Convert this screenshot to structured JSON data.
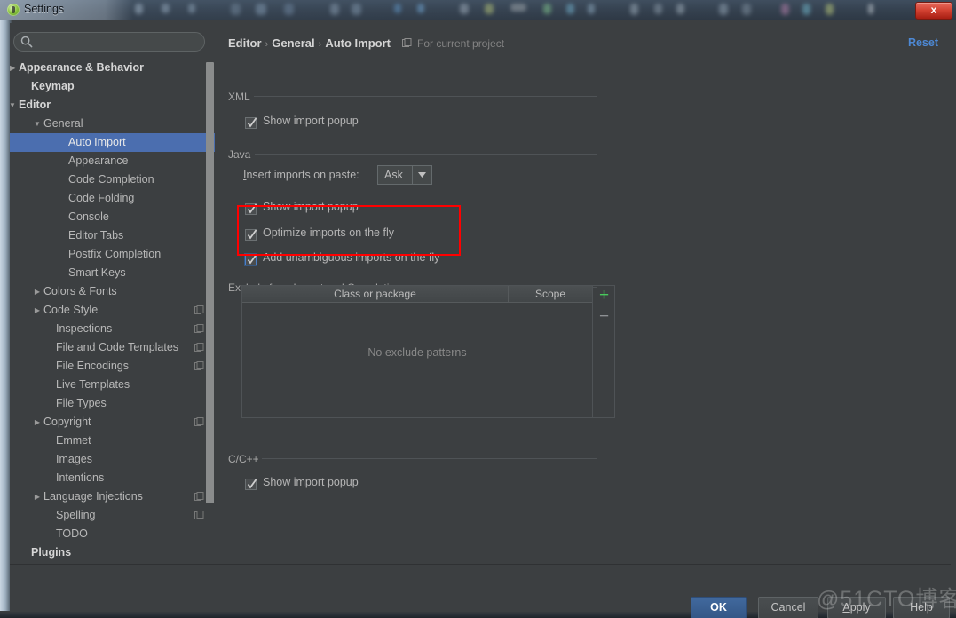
{
  "window": {
    "title": "Settings",
    "close_label": "x",
    "app_icon": "intellij-idea-icon"
  },
  "sidebar": {
    "search": {
      "value": "",
      "placeholder": "",
      "icon": "search-icon"
    },
    "items": [
      {
        "label": "Appearance & Behavior",
        "indent": 10,
        "arrow": "collapsed",
        "bold": true,
        "selected": false,
        "project_icon": false
      },
      {
        "label": "Keymap",
        "indent": 24,
        "arrow": "none",
        "bold": true,
        "selected": false,
        "project_icon": false
      },
      {
        "label": "Editor",
        "indent": 10,
        "arrow": "expanded",
        "bold": true,
        "selected": false,
        "project_icon": false
      },
      {
        "label": "General",
        "indent": 38,
        "arrow": "expanded",
        "bold": false,
        "selected": false,
        "project_icon": false
      },
      {
        "label": "Auto Import",
        "indent": 66,
        "arrow": "none",
        "bold": false,
        "selected": true,
        "project_icon": false
      },
      {
        "label": "Appearance",
        "indent": 66,
        "arrow": "none",
        "bold": false,
        "selected": false,
        "project_icon": false
      },
      {
        "label": "Code Completion",
        "indent": 66,
        "arrow": "none",
        "bold": false,
        "selected": false,
        "project_icon": false
      },
      {
        "label": "Code Folding",
        "indent": 66,
        "arrow": "none",
        "bold": false,
        "selected": false,
        "project_icon": false
      },
      {
        "label": "Console",
        "indent": 66,
        "arrow": "none",
        "bold": false,
        "selected": false,
        "project_icon": false
      },
      {
        "label": "Editor Tabs",
        "indent": 66,
        "arrow": "none",
        "bold": false,
        "selected": false,
        "project_icon": false
      },
      {
        "label": "Postfix Completion",
        "indent": 66,
        "arrow": "none",
        "bold": false,
        "selected": false,
        "project_icon": false
      },
      {
        "label": "Smart Keys",
        "indent": 66,
        "arrow": "none",
        "bold": false,
        "selected": false,
        "project_icon": false
      },
      {
        "label": "Colors & Fonts",
        "indent": 38,
        "arrow": "collapsed",
        "bold": false,
        "selected": false,
        "project_icon": false
      },
      {
        "label": "Code Style",
        "indent": 38,
        "arrow": "collapsed",
        "bold": false,
        "selected": false,
        "project_icon": true
      },
      {
        "label": "Inspections",
        "indent": 52,
        "arrow": "none",
        "bold": false,
        "selected": false,
        "project_icon": true
      },
      {
        "label": "File and Code Templates",
        "indent": 52,
        "arrow": "none",
        "bold": false,
        "selected": false,
        "project_icon": true
      },
      {
        "label": "File Encodings",
        "indent": 52,
        "arrow": "none",
        "bold": false,
        "selected": false,
        "project_icon": true
      },
      {
        "label": "Live Templates",
        "indent": 52,
        "arrow": "none",
        "bold": false,
        "selected": false,
        "project_icon": false
      },
      {
        "label": "File Types",
        "indent": 52,
        "arrow": "none",
        "bold": false,
        "selected": false,
        "project_icon": false
      },
      {
        "label": "Copyright",
        "indent": 38,
        "arrow": "collapsed",
        "bold": false,
        "selected": false,
        "project_icon": true
      },
      {
        "label": "Emmet",
        "indent": 52,
        "arrow": "none",
        "bold": false,
        "selected": false,
        "project_icon": false
      },
      {
        "label": "Images",
        "indent": 52,
        "arrow": "none",
        "bold": false,
        "selected": false,
        "project_icon": false
      },
      {
        "label": "Intentions",
        "indent": 52,
        "arrow": "none",
        "bold": false,
        "selected": false,
        "project_icon": false
      },
      {
        "label": "Language Injections",
        "indent": 38,
        "arrow": "collapsed",
        "bold": false,
        "selected": false,
        "project_icon": true
      },
      {
        "label": "Spelling",
        "indent": 52,
        "arrow": "none",
        "bold": false,
        "selected": false,
        "project_icon": true
      },
      {
        "label": "TODO",
        "indent": 52,
        "arrow": "none",
        "bold": false,
        "selected": false,
        "project_icon": false
      },
      {
        "label": "Plugins",
        "indent": 24,
        "arrow": "none",
        "bold": true,
        "selected": false,
        "project_icon": false
      }
    ]
  },
  "content": {
    "breadcrumb": {
      "part1": "Editor",
      "part2": "General",
      "part3": "Auto Import",
      "separator": "›",
      "scope_text": "For current project",
      "scope_icon": "project-scope-icon"
    },
    "reset_label": "Reset",
    "groups": {
      "xml": {
        "title": "XML",
        "show_import_popup": {
          "label": "Show import popup",
          "checked": true,
          "focused": false
        }
      },
      "java": {
        "title": "Java",
        "insert_imports_label": "Insert imports on paste:",
        "insert_imports_mnemonic": "I",
        "insert_imports_rest": "nsert imports on paste:",
        "insert_imports_value": "Ask",
        "show_import_popup": {
          "label": "Show import popup",
          "checked": true,
          "focused": false
        },
        "optimize_imports": {
          "label": "Optimize imports on the fly",
          "checked": true,
          "focused": false
        },
        "add_unambiguous": {
          "label": "Add unambiguous imports on the fly",
          "checked": true,
          "focused": true
        }
      },
      "exclude": {
        "title": "Exclude from Import and Completion",
        "columns": [
          "Class or package",
          "Scope"
        ],
        "empty_text": "No exclude patterns",
        "rows": [],
        "add_label": "+",
        "remove_label": "−"
      },
      "cpp": {
        "title": "C/C++",
        "show_import_popup": {
          "label": "Show import popup",
          "checked": true,
          "focused": false
        }
      }
    }
  },
  "footer": {
    "ok": "OK",
    "cancel": "Cancel",
    "apply_mnemonic": "A",
    "apply_rest": "pply",
    "help": "Help"
  },
  "watermark": "@51CTO博客",
  "colors": {
    "background": "#3c3f41",
    "selection_blue": "#4b6eaf",
    "link_blue": "#4d88d4",
    "annotation_red": "#ff0000",
    "add_green": "#48c95c",
    "ok_blue": "#41699e"
  }
}
